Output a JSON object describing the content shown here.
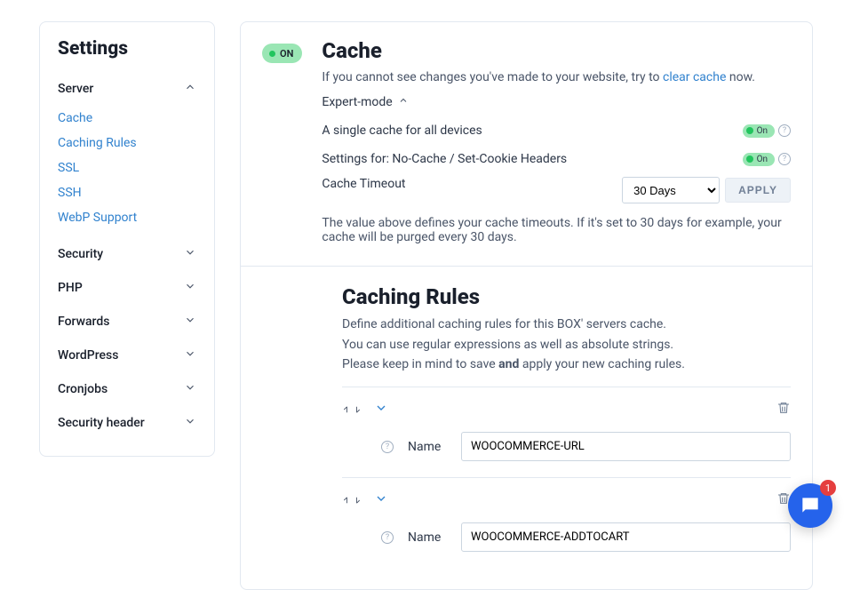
{
  "sidebar": {
    "title": "Settings",
    "server": {
      "label": "Server",
      "items": [
        "Cache",
        "Caching Rules",
        "SSL",
        "SSH",
        "WebP Support"
      ]
    },
    "collapsed": [
      "Security",
      "PHP",
      "Forwards",
      "WordPress",
      "Cronjobs",
      "Security header"
    ]
  },
  "cache": {
    "pill": "ON",
    "title": "Cache",
    "desc_pre": "If you cannot see changes you've made to your website, try to ",
    "desc_link": "clear cache",
    "desc_post": " now.",
    "expert": "Expert-mode",
    "single_cache_label": "A single cache for all devices",
    "toggle_on": "On",
    "nocache_label": "Settings for: No-Cache / Set-Cookie Headers",
    "timeout_label": "Cache Timeout",
    "timeout_value": "30 Days",
    "apply": "APPLY",
    "timeout_desc": "The value above defines your cache timeouts. If it's set to 30 days for example, your cache will be purged every 30 days."
  },
  "rules": {
    "title": "Caching Rules",
    "desc1": "Define additional caching rules for this BOX' servers cache.",
    "desc2": "You can use regular expressions as well as absolute strings.",
    "desc3_pre": "Please keep in mind to save ",
    "desc3_bold": "and",
    "desc3_post": " apply your new caching rules.",
    "name_label": "Name",
    "items": [
      {
        "name": "WOOCOMMERCE-URL"
      },
      {
        "name": "WOOCOMMERCE-ADDTOCART"
      }
    ]
  },
  "chat": {
    "badge": "1"
  }
}
